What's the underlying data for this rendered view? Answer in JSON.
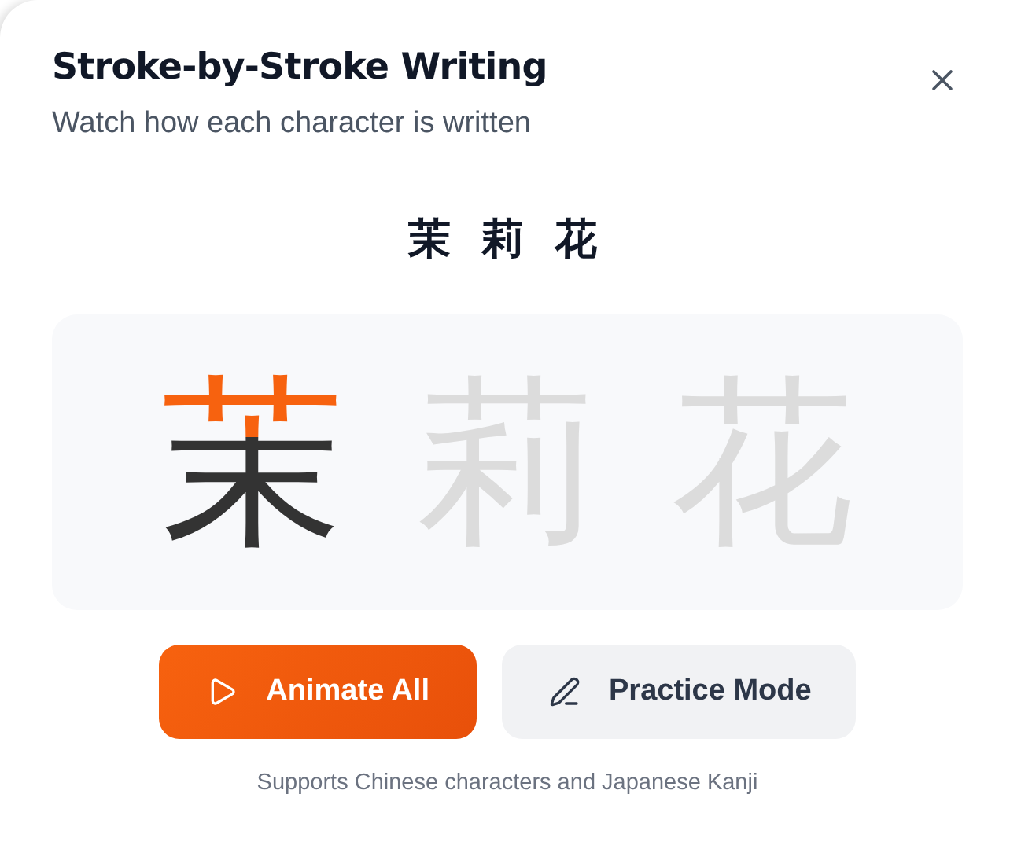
{
  "dialog": {
    "title": "Stroke-by-Stroke Writing",
    "subtitle": "Watch how each character is written"
  },
  "word": "茉 莉 花",
  "characters": [
    {
      "char": "茉",
      "kind": "active"
    },
    {
      "char": "莉",
      "kind": "pending"
    },
    {
      "char": "花",
      "kind": "pending"
    }
  ],
  "buttons": [
    {
      "label": "Animate All",
      "kind": "primary"
    },
    {
      "label": "Practice Mode",
      "kind": "secondary"
    }
  ],
  "footnote": "Supports Chinese characters and Japanese Kanji"
}
